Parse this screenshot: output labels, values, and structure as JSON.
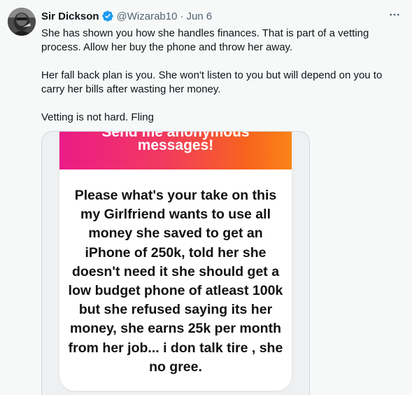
{
  "tweet": {
    "author": {
      "display_name": "Sir Dickson",
      "handle": "@Wizarab10",
      "date": "Jun 6",
      "separator": "·",
      "verified_icon": "verified-badge-icon",
      "avatar_icon": "avatar-image"
    },
    "more_icon": "more-options-icon",
    "text": {
      "p1": "She has shown you how she handles finances. That is part of a vetting process. Allow her buy the phone and throw her away.",
      "p2": "Her fall back plan is you. She won't listen to you but will depend on you to carry her bills after wasting her money.",
      "p3": "Vetting is not hard. Fling"
    },
    "media": {
      "banner_top_text": "Send me anonymous",
      "banner_title": "messages!",
      "question": "Please what's your take on this my Girlfriend wants to use all money she saved to get an iPhone of 250k, told her she doesn't need it she should get a low budget phone of atleast 100k but she refused saying its her money, she earns 25k per month from her job... i don talk tire , she no gree.",
      "colors": {
        "gradient_start": "#ec1b87",
        "gradient_end": "#fb8417"
      }
    },
    "colors": {
      "verified": "#1d9bf0",
      "secondary_text": "#536471",
      "primary_text": "#0f1419"
    }
  }
}
